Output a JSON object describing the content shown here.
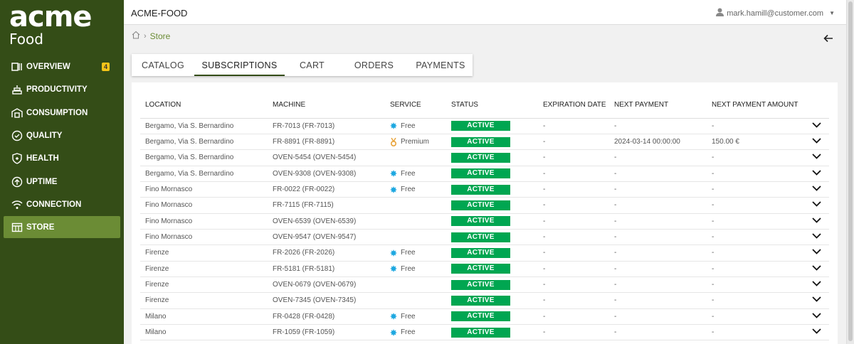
{
  "logo": {
    "main": "acme",
    "sub": "Food"
  },
  "sidebar": {
    "items": [
      {
        "label": "OVERVIEW",
        "icon": "overview-icon",
        "badge": "4"
      },
      {
        "label": "PRODUCTIVITY",
        "icon": "productivity-icon"
      },
      {
        "label": "CONSUMPTION",
        "icon": "consumption-icon"
      },
      {
        "label": "QUALITY",
        "icon": "quality-icon"
      },
      {
        "label": "HEALTH",
        "icon": "health-icon"
      },
      {
        "label": "UPTIME",
        "icon": "uptime-icon"
      },
      {
        "label": "CONNECTION",
        "icon": "connection-icon"
      },
      {
        "label": "STORE",
        "icon": "store-icon",
        "active": true
      }
    ]
  },
  "header": {
    "title": "ACME-FOOD",
    "user": "mark.hamill@customer.com"
  },
  "breadcrumb": {
    "current": "Store"
  },
  "tabs": [
    {
      "label": "CATALOG"
    },
    {
      "label": "SUBSCRIPTIONS",
      "active": true
    },
    {
      "label": "CART"
    },
    {
      "label": "ORDERS"
    },
    {
      "label": "PAYMENTS"
    }
  ],
  "table": {
    "columns": [
      "LOCATION",
      "MACHINE",
      "SERVICE",
      "STATUS",
      "EXPIRATION DATE",
      "NEXT PAYMENT",
      "NEXT PAYMENT AMOUNT"
    ],
    "rows": [
      {
        "location": "Bergamo, Via S. Bernardino",
        "machine": "FR-7013 (FR-7013)",
        "service": "Free",
        "service_type": "free",
        "status": "ACTIVE",
        "expiration": "-",
        "next_payment": "-",
        "amount": "-"
      },
      {
        "location": "Bergamo, Via S. Bernardino",
        "machine": "FR-8891 (FR-8891)",
        "service": "Premium",
        "service_type": "premium",
        "status": "ACTIVE",
        "expiration": "-",
        "next_payment": "2024-03-14 00:00:00",
        "amount": "150.00 €"
      },
      {
        "location": "Bergamo, Via S. Bernardino",
        "machine": "OVEN-5454 (OVEN-5454)",
        "service": "",
        "service_type": "none",
        "status": "ACTIVE",
        "expiration": "-",
        "next_payment": "-",
        "amount": "-"
      },
      {
        "location": "Bergamo, Via S. Bernardino",
        "machine": "OVEN-9308 (OVEN-9308)",
        "service": "Free",
        "service_type": "free",
        "status": "ACTIVE",
        "expiration": "-",
        "next_payment": "-",
        "amount": "-"
      },
      {
        "location": "Fino Mornasco",
        "machine": "FR-0022 (FR-0022)",
        "service": "Free",
        "service_type": "free",
        "status": "ACTIVE",
        "expiration": "-",
        "next_payment": "-",
        "amount": "-"
      },
      {
        "location": "Fino Mornasco",
        "machine": "FR-7115 (FR-7115)",
        "service": "",
        "service_type": "none",
        "status": "ACTIVE",
        "expiration": "-",
        "next_payment": "-",
        "amount": "-"
      },
      {
        "location": "Fino Mornasco",
        "machine": "OVEN-6539 (OVEN-6539)",
        "service": "",
        "service_type": "none",
        "status": "ACTIVE",
        "expiration": "-",
        "next_payment": "-",
        "amount": "-"
      },
      {
        "location": "Fino Mornasco",
        "machine": "OVEN-9547 (OVEN-9547)",
        "service": "",
        "service_type": "none",
        "status": "ACTIVE",
        "expiration": "-",
        "next_payment": "-",
        "amount": "-"
      },
      {
        "location": "Firenze",
        "machine": "FR-2026 (FR-2026)",
        "service": "Free",
        "service_type": "free",
        "status": "ACTIVE",
        "expiration": "-",
        "next_payment": "-",
        "amount": "-"
      },
      {
        "location": "Firenze",
        "machine": "FR-5181 (FR-5181)",
        "service": "Free",
        "service_type": "free",
        "status": "ACTIVE",
        "expiration": "-",
        "next_payment": "-",
        "amount": "-"
      },
      {
        "location": "Firenze",
        "machine": "OVEN-0679 (OVEN-0679)",
        "service": "",
        "service_type": "none",
        "status": "ACTIVE",
        "expiration": "-",
        "next_payment": "-",
        "amount": "-"
      },
      {
        "location": "Firenze",
        "machine": "OVEN-7345 (OVEN-7345)",
        "service": "",
        "service_type": "none",
        "status": "ACTIVE",
        "expiration": "-",
        "next_payment": "-",
        "amount": "-"
      },
      {
        "location": "Milano",
        "machine": "FR-0428 (FR-0428)",
        "service": "Free",
        "service_type": "free",
        "status": "ACTIVE",
        "expiration": "-",
        "next_payment": "-",
        "amount": "-"
      },
      {
        "location": "Milano",
        "machine": "FR-1059 (FR-1059)",
        "service": "Free",
        "service_type": "free",
        "status": "ACTIVE",
        "expiration": "-",
        "next_payment": "-",
        "amount": "-"
      }
    ]
  },
  "colors": {
    "sidebar": "#344d17",
    "sidebar_active": "#6b8c35",
    "status_active": "#00a651",
    "free_dot": "#1ca7e0",
    "premium_medal": "#e8a33a",
    "badge": "#f5c518"
  }
}
